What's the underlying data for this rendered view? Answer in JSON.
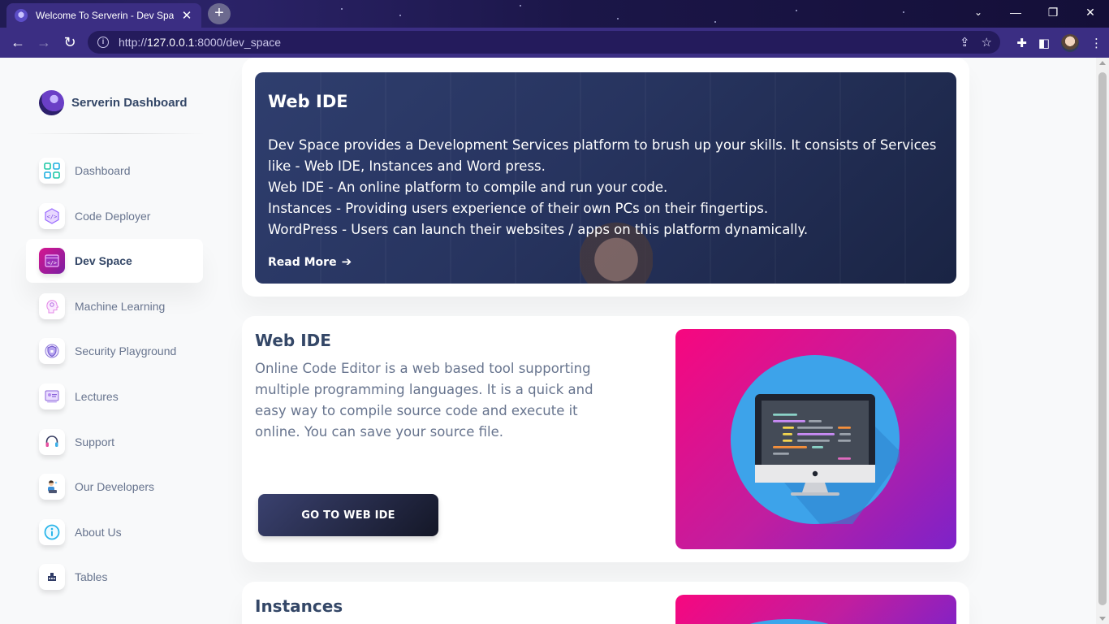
{
  "browser": {
    "tab_title": "Welcome To Serverin - Dev Space",
    "url_prefix": "http://",
    "url_host": "127.0.0.1",
    "url_rest": ":8000/dev_space"
  },
  "sidebar": {
    "brand": "Serverin Dashboard",
    "items": [
      {
        "label": "Dashboard",
        "icon": "dashboard-icon",
        "active": false
      },
      {
        "label": "Code Deployer",
        "icon": "code-deployer-icon",
        "active": false
      },
      {
        "label": "Dev Space",
        "icon": "dev-space-icon",
        "active": true
      },
      {
        "label": "Machine Learning",
        "icon": "machine-learning-icon",
        "active": false
      },
      {
        "label": "Security Playground",
        "icon": "security-icon",
        "active": false
      },
      {
        "label": "Lectures",
        "icon": "lectures-icon",
        "active": false
      },
      {
        "label": "Support",
        "icon": "headset-icon",
        "active": false
      },
      {
        "label": "Our Developers",
        "icon": "developer-icon",
        "active": false
      },
      {
        "label": "About Us",
        "icon": "info-icon",
        "active": false
      },
      {
        "label": "Tables",
        "icon": "table-icon",
        "active": false
      }
    ]
  },
  "hero": {
    "title": "Web IDE",
    "lines": [
      "Dev Space provides a Development Services platform to brush up your skills. It consists of Services like - Web IDE, Instances and Word press.",
      "Web IDE - An online platform to compile and run your code.",
      "Instances - Providing users experience of their own PCs on their fingertips.",
      "WordPress - Users can launch their websites / apps on this platform dynamically."
    ],
    "link": "Read More"
  },
  "webide": {
    "title": "Web IDE",
    "description": "Online Code Editor is a web based tool supporting multiple programming languages. It is a quick and easy way to compile source code and execute it online. You can save your source file.",
    "button": "GO TO WEB IDE"
  },
  "instances": {
    "title": "Instances"
  },
  "colors": {
    "accent_gradient_start": "#f7077f",
    "accent_gradient_end": "#7d22c9",
    "button_dark": "#141727",
    "text_dark": "#344767",
    "text_muted": "#67748e"
  }
}
